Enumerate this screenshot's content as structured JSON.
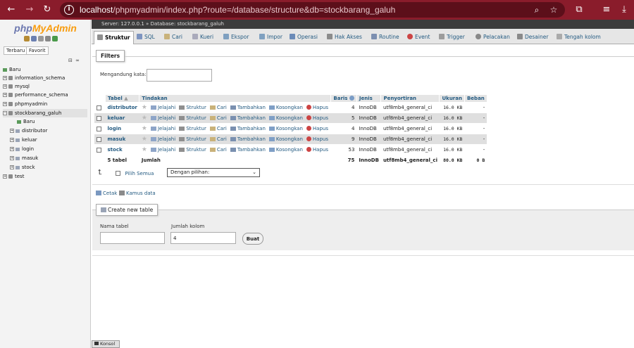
{
  "browser": {
    "url_host": "localhost",
    "url_path": "/phpmyadmin/index.php?route=/database/structure&db=stockbarang_galuh",
    "back_icon": "arrow-left-icon",
    "accent_color": "#8a1c2b"
  },
  "sidebar": {
    "logo_php": "php",
    "logo_myadmin": "MyAdmin",
    "tab_recent": "Terbaru",
    "tab_favorite": "Favorit",
    "tree": [
      {
        "label": "Baru"
      },
      {
        "label": "information_schema"
      },
      {
        "label": "mysql"
      },
      {
        "label": "performance_schema"
      },
      {
        "label": "phpmyadmin"
      },
      {
        "label": "stockbarang_galuh"
      },
      {
        "label": "Baru"
      },
      {
        "label": "distributor"
      },
      {
        "label": "keluar"
      },
      {
        "label": "login"
      },
      {
        "label": "masuk"
      },
      {
        "label": "stock"
      },
      {
        "label": "test"
      }
    ]
  },
  "breadcrumb": {
    "server": "Server: 127.0.0.1",
    "sep": "»",
    "database": "Database: stockbarang_galuh"
  },
  "tabs": [
    {
      "label": "Struktur"
    },
    {
      "label": "SQL"
    },
    {
      "label": "Cari"
    },
    {
      "label": "Kueri"
    },
    {
      "label": "Ekspor"
    },
    {
      "label": "Impor"
    },
    {
      "label": "Operasi"
    },
    {
      "label": "Hak Akses"
    },
    {
      "label": "Routine"
    },
    {
      "label": "Event"
    },
    {
      "label": "Trigger"
    },
    {
      "label": "Pelacakan"
    },
    {
      "label": "Desainer"
    },
    {
      "label": "Tengah kolom"
    }
  ],
  "filters": {
    "legend": "Filters",
    "label": "Mengandung kata:",
    "value": ""
  },
  "table": {
    "headers": {
      "tabel": "Tabel",
      "sort_arrow": "▲",
      "tindakan": "Tindakan",
      "baris": "Baris",
      "jenis": "Jenis",
      "penyortiran": "Penyortiran",
      "ukuran": "Ukuran",
      "beban": "Beban"
    },
    "actions": {
      "browse": "Jelajahi",
      "structure": "Struktur",
      "search": "Cari",
      "insert": "Tambahkan",
      "empty": "Kosongkan",
      "drop": "Hapus"
    },
    "rows": [
      {
        "name": "distributor",
        "rows": "4",
        "engine": "InnoDB",
        "collation": "utf8mb4_general_ci",
        "size": "16.0 KB",
        "overhead": "-"
      },
      {
        "name": "keluar",
        "rows": "5",
        "engine": "InnoDB",
        "collation": "utf8mb4_general_ci",
        "size": "16.0 KB",
        "overhead": "-"
      },
      {
        "name": "login",
        "rows": "4",
        "engine": "InnoDB",
        "collation": "utf8mb4_general_ci",
        "size": "16.0 KB",
        "overhead": "-"
      },
      {
        "name": "masuk",
        "rows": "9",
        "engine": "InnoDB",
        "collation": "utf8mb4_general_ci",
        "size": "16.0 KB",
        "overhead": "-"
      },
      {
        "name": "stock",
        "rows": "53",
        "engine": "InnoDB",
        "collation": "utf8mb4_general_ci",
        "size": "16.0 KB",
        "overhead": "-"
      }
    ],
    "footer": {
      "count": "5 tabel",
      "label": "Jumlah",
      "rows": "75",
      "engine": "InnoDB",
      "collation": "utf8mb4_general_ci",
      "size": "80.0 KB",
      "overhead": "0 B"
    }
  },
  "bulk": {
    "select_all": "Pilih Semua",
    "with_selected": "Dengan pilihan:"
  },
  "links": {
    "print": "Cetak",
    "dictionary": "Kamus data"
  },
  "create_table": {
    "legend": "Create new table",
    "name_label": "Nama tabel",
    "name_value": "",
    "columns_label": "Jumlah kolom",
    "columns_value": "4",
    "submit": "Buat"
  },
  "console": {
    "label": "Konsol"
  }
}
